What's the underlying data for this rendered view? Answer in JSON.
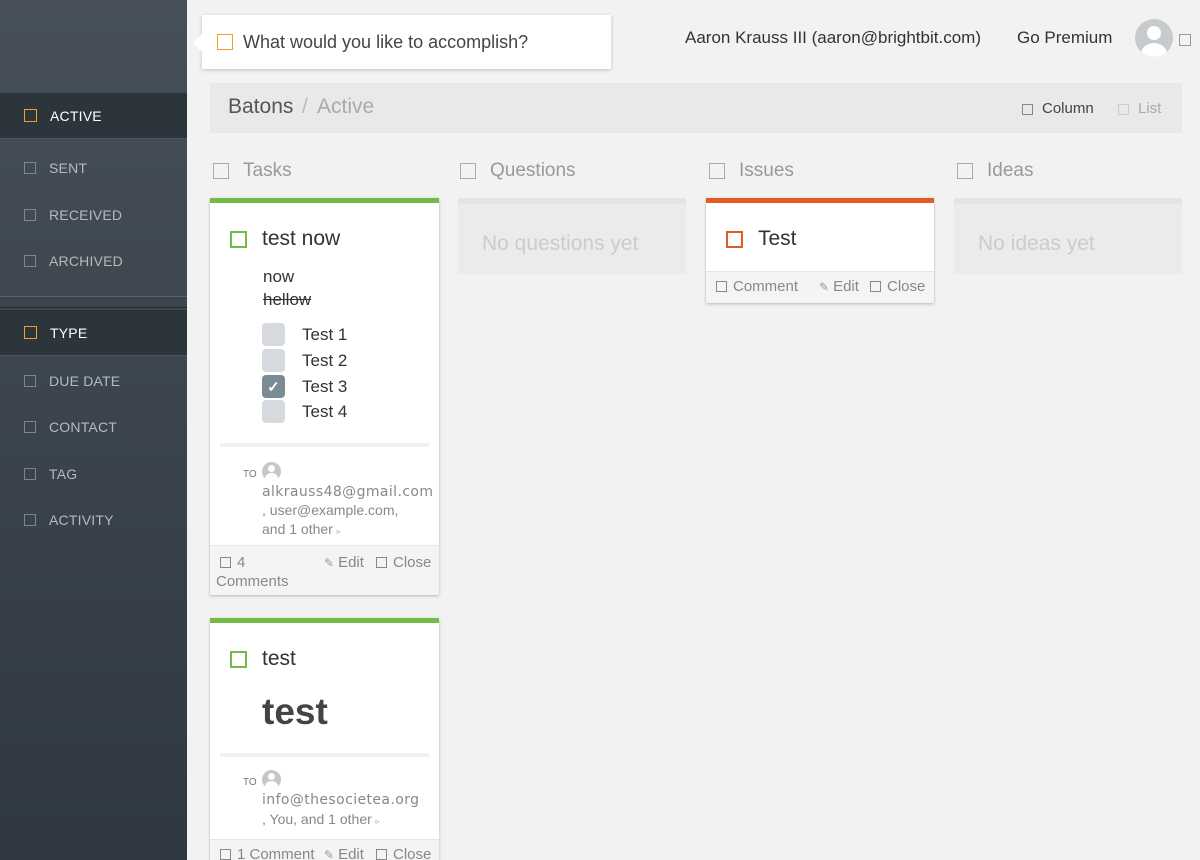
{
  "sidebar": {
    "status_items": [
      {
        "label": "ACTIVE"
      },
      {
        "label": "SENT"
      },
      {
        "label": "RECEIVED"
      },
      {
        "label": "ARCHIVED"
      }
    ],
    "filter_items": [
      {
        "label": "TYPE"
      },
      {
        "label": "DUE DATE"
      },
      {
        "label": "CONTACT"
      },
      {
        "label": "TAG"
      },
      {
        "label": "ACTIVITY"
      }
    ]
  },
  "header": {
    "ask_placeholder": "What would you like to accomplish?",
    "user": "Aaron Krauss III (aaron@brightbit.com)",
    "premium": "Go Premium"
  },
  "breadcrumb": {
    "root": "Batons",
    "separator": "/",
    "current": "Active"
  },
  "view_toggle": {
    "column": "Column",
    "list": "List"
  },
  "columns": [
    {
      "title": "Tasks"
    },
    {
      "title": "Questions",
      "empty": "No questions yet"
    },
    {
      "title": "Issues"
    },
    {
      "title": "Ideas",
      "empty": "No ideas yet"
    }
  ],
  "task_cards": [
    {
      "title": "test now",
      "line1": "now",
      "line2": "hellow",
      "checklist": [
        {
          "label": "Test 1",
          "checked": false
        },
        {
          "label": "Test 2",
          "checked": false
        },
        {
          "label": "Test 3",
          "checked": true
        },
        {
          "label": "Test 4",
          "checked": false
        }
      ],
      "to_label": "TO",
      "recipients_line1": "alkrauss48@gmail.com",
      "recipients_line2": ", user@example.com,",
      "recipients_line3": "and 1 other",
      "comments_count": "4",
      "comments_label": "Comments",
      "edit": "Edit",
      "close": "Close"
    },
    {
      "title": "test",
      "big_text": "test",
      "to_label": "TO",
      "recipients_line1": "info@thesocietea.org",
      "recipients_line2": ", You, and 1 other",
      "comments": "1 Comment",
      "edit": "Edit",
      "close": "Close"
    }
  ],
  "issue_card": {
    "title": "Test",
    "comment": "Comment",
    "edit": "Edit",
    "close": "Close"
  },
  "colors": {
    "sidebar_accent": "#f2a02a",
    "task_accent": "#72bb46",
    "issue_accent": "#e25a24"
  }
}
